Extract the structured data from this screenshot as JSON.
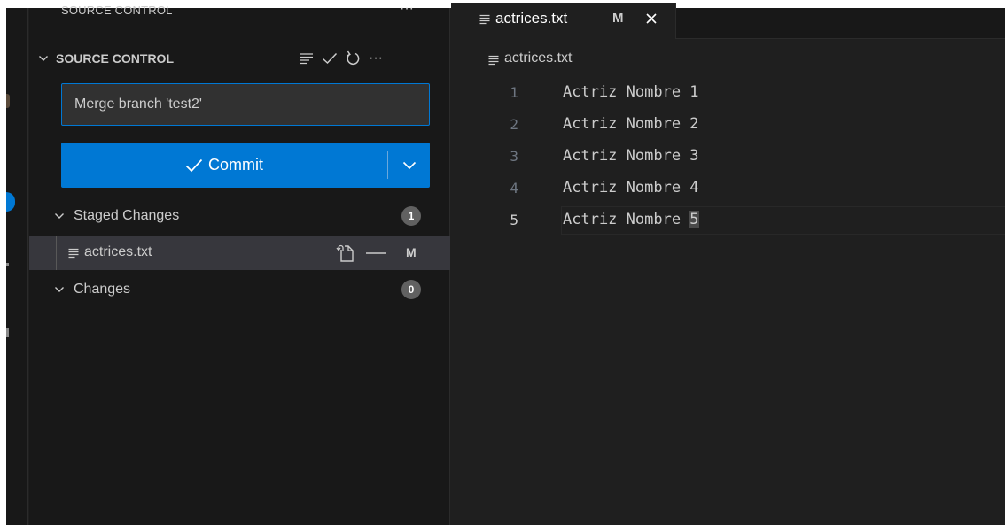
{
  "sidebar": {
    "view_header": "SOURCE CONTROL",
    "view_more": "···",
    "section_title": "SOURCE CONTROL",
    "section_more": "···",
    "commit_message": "Merge branch 'test2'",
    "commit_button": {
      "label": "Commit"
    },
    "groups": [
      {
        "label": "Staged Changes",
        "count": "1"
      },
      {
        "label": "Changes",
        "count": "0"
      }
    ],
    "staged_file": {
      "name": "actrices.txt",
      "status": "M"
    }
  },
  "editor": {
    "tab": {
      "name": "actrices.txt",
      "badge": "M"
    },
    "breadcrumb": "actrices.txt",
    "lines": [
      {
        "number": "1",
        "text": "Actriz Nombre 1"
      },
      {
        "number": "2",
        "text": "Actriz Nombre 2"
      },
      {
        "number": "3",
        "text": "Actriz Nombre 3"
      },
      {
        "number": "4",
        "text": "Actriz Nombre 4"
      },
      {
        "number": "5",
        "text": "Actriz Nombre ",
        "cursor_char": "5"
      }
    ]
  },
  "icons": {
    "view_as_tree": "list-flat-icon",
    "commit_action": "check-icon",
    "refresh": "refresh-icon",
    "more": "ellipsis-icon",
    "text_file": "text-file-icon",
    "open_file": "go-to-file-icon",
    "unstage": "minus-icon",
    "close": "close-icon",
    "dropdown": "chevron-down-icon"
  },
  "colors": {
    "accent": "#0078d4",
    "sidebar_bg": "#181818",
    "editor_bg": "#1f1f1f",
    "selected_row": "#37373d",
    "badge": "#616161"
  }
}
